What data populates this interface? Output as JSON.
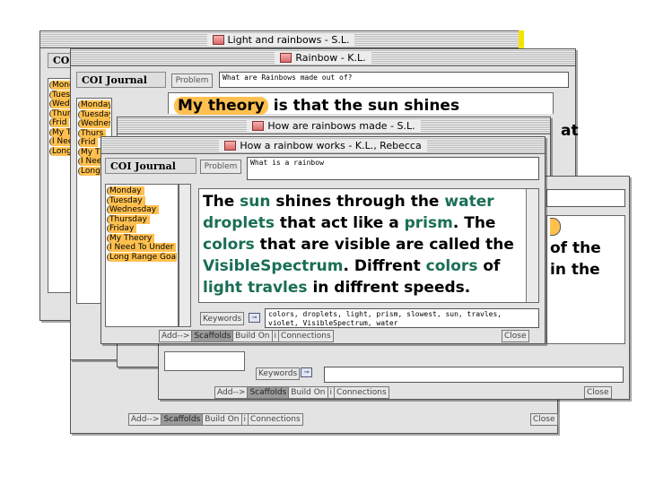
{
  "windows": {
    "light_rainbows": {
      "title": "Light and rainbows - S.L.",
      "journal_title": "COI",
      "journal_items": [
        "Mond",
        "Tues",
        "Wed",
        "Thur",
        "Frid",
        "My T",
        "I Nee",
        "Long"
      ],
      "add_label": "Add-->",
      "scaffolds_label": "Scaffolds",
      "build_on_label": "Build On",
      "info_label": "i",
      "connections_label": "Connections",
      "close_label": "Close"
    },
    "rainbow_kl": {
      "title": "Rainbow - K.L.",
      "journal_title": "COI Journal",
      "journal_items": [
        "Monday",
        "Tuesday",
        "Wednesd",
        "Thurs",
        "Frid",
        "My T",
        "I Nee",
        "Long"
      ],
      "problem_label": "Problem",
      "problem_text": "What are Rainbows made out of?",
      "theory_tag": "My theory",
      "body_text": " is that the sun shines",
      "partial_right": "at"
    },
    "how_made": {
      "title": "How are rainbows made - S.L.",
      "partial_line1": "of the",
      "partial_line2": "in the",
      "keywords_label": "Keywords",
      "add_label": "Add-->",
      "scaffolds_label": "Scaffolds",
      "build_on_label": "Build On",
      "info_label": "i",
      "connections_label": "Connections",
      "close_label": "Close"
    },
    "how_works": {
      "title": "How a rainbow works - K.L., Rebecca",
      "journal_title": "COI Journal",
      "journal_items": [
        "Monday",
        "Tuesday",
        "Wednesday",
        "Thursday",
        "Friday",
        "My Theory",
        "I Need To Under",
        "Long Range Goal"
      ],
      "problem_label": "Problem",
      "problem_text": "What is a rainbow",
      "body_segments": [
        {
          "text": "The ",
          "kw": false
        },
        {
          "text": "sun",
          "kw": true
        },
        {
          "text": " shines through the ",
          "kw": false
        },
        {
          "text": "water droplets",
          "kw": true
        },
        {
          "text": " that act like a ",
          "kw": false
        },
        {
          "text": "prism",
          "kw": true
        },
        {
          "text": ". The ",
          "kw": false
        },
        {
          "text": "colors",
          "kw": true
        },
        {
          "text": " that are visible are called the ",
          "kw": false
        },
        {
          "text": "VisibleSpectrum",
          "kw": true
        },
        {
          "text": ". Diffrent ",
          "kw": false
        },
        {
          "text": "colors",
          "kw": true
        },
        {
          "text": " of ",
          "kw": false
        },
        {
          "text": "light",
          "kw": true
        },
        {
          "text": " ",
          "kw": false
        },
        {
          "text": "travles",
          "kw": true
        },
        {
          "text": " in diffrent speeds.",
          "kw": false
        }
      ],
      "keywords_label": "Keywords",
      "keywords_text": "colors, droplets, light, prism, slowest, sun, travles, violet, VisibleSpectrum, water",
      "add_label": "Add-->",
      "scaffolds_label": "Scaffolds",
      "build_on_label": "Build On",
      "info_label": "i",
      "connections_label": "Connections",
      "close_label": "Close"
    }
  },
  "colors": {
    "tag_orange": "#ffc04f",
    "keyword_green": "#1a6e55",
    "window_gray": "#e3e3e3"
  }
}
